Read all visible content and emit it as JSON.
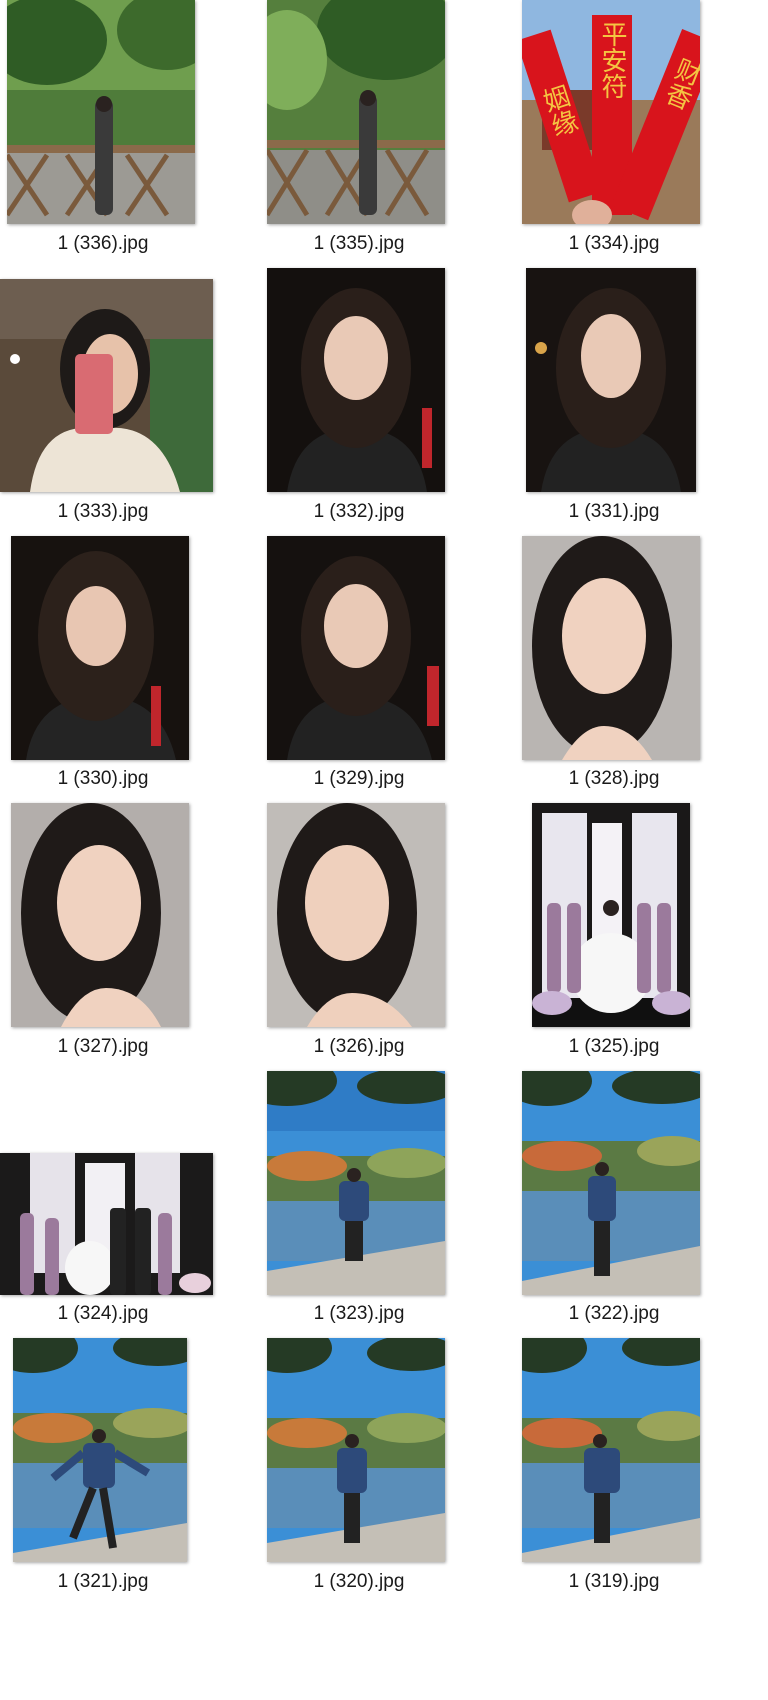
{
  "files": [
    {
      "name": "1 (336).jpg",
      "scene": "bamboo-garden-woman"
    },
    {
      "name": "1 (335).jpg",
      "scene": "bamboo-garden-woman-2"
    },
    {
      "name": "1 (334).jpg",
      "scene": "red-blessing-ribbons"
    },
    {
      "name": "1 (333).jpg",
      "scene": "mirror-selfie"
    },
    {
      "name": "1 (332).jpg",
      "scene": "night-portrait"
    },
    {
      "name": "1 (331).jpg",
      "scene": "night-portrait"
    },
    {
      "name": "1 (330).jpg",
      "scene": "night-portrait"
    },
    {
      "name": "1 (329).jpg",
      "scene": "night-portrait"
    },
    {
      "name": "1 (328).jpg",
      "scene": "indoor-portrait"
    },
    {
      "name": "1 (327).jpg",
      "scene": "indoor-portrait"
    },
    {
      "name": "1 (326).jpg",
      "scene": "indoor-portrait"
    },
    {
      "name": "1 (325).jpg",
      "scene": "wedding-bridesmaids"
    },
    {
      "name": "1 (324).jpg",
      "scene": "wedding-group"
    },
    {
      "name": "1 (323).jpg",
      "scene": "autumn-lake"
    },
    {
      "name": "1 (322).jpg",
      "scene": "autumn-lake"
    },
    {
      "name": "1 (321).jpg",
      "scene": "autumn-lake-pose"
    },
    {
      "name": "1 (320).jpg",
      "scene": "autumn-lake"
    },
    {
      "name": "1 (319).jpg",
      "scene": "autumn-lake"
    }
  ],
  "ribbon_text": {
    "left": "姻缘",
    "middle": "平安符",
    "right": "财香"
  },
  "colors": {
    "background": "#ffffff",
    "caption_text": "#1a1a1a",
    "ribbon_red": "#d8141c",
    "ribbon_gold": "#f4c542"
  }
}
